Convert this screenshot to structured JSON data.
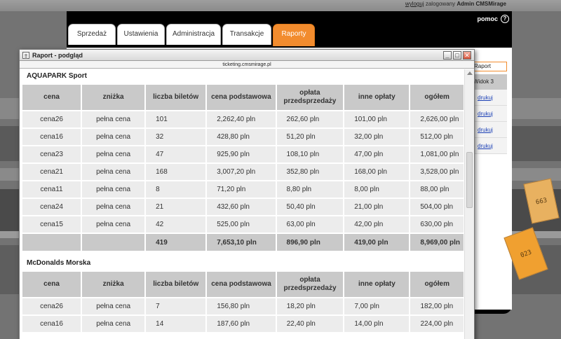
{
  "topbar": {
    "logout": "wyloguj",
    "logged_in": "zalogowany",
    "user": "Admin CMSMirage"
  },
  "app": {
    "help_label": "pomoc",
    "tabs": [
      {
        "label": "Sprzedaż"
      },
      {
        "label": "Ustawienia"
      },
      {
        "label": "Administracja"
      },
      {
        "label": "Transakcje"
      },
      {
        "label": "Raporty"
      }
    ],
    "active_tab": "Raporty",
    "accent_color": "#f28c2e",
    "side": {
      "header": "Raport",
      "view_label": "Widok 3",
      "links": [
        "drukuj",
        "drukuj",
        "drukuj",
        "drukuj"
      ]
    },
    "tickets": [
      "663",
      "023"
    ]
  },
  "window": {
    "title": "Raport - podgląd",
    "url": "ticketing.cmsmirage.pl",
    "buttons": {
      "minimize": "_",
      "maximize": "□",
      "close": "✕"
    }
  },
  "columns": [
    "cena",
    "zniżka",
    "liczba biletów",
    "cena podstawowa",
    "opłata przedsprzedaży",
    "inne opłaty",
    "ogółem"
  ],
  "sections": [
    {
      "title": "AQUAPARK Sport",
      "rows": [
        [
          "cena26",
          "pełna cena",
          "101",
          "2,262,40 pln",
          "262,60 pln",
          "101,00 pln",
          "2,626,00 pln"
        ],
        [
          "cena16",
          "pełna cena",
          "32",
          "428,80 pln",
          "51,20 pln",
          "32,00 pln",
          "512,00 pln"
        ],
        [
          "cena23",
          "pełna cena",
          "47",
          "925,90 pln",
          "108,10 pln",
          "47,00 pln",
          "1,081,00 pln"
        ],
        [
          "cena21",
          "pełna cena",
          "168",
          "3,007,20 pln",
          "352,80 pln",
          "168,00 pln",
          "3,528,00 pln"
        ],
        [
          "cena11",
          "pełna cena",
          "8",
          "71,20 pln",
          "8,80 pln",
          "8,00 pln",
          "88,00 pln"
        ],
        [
          "cena24",
          "pełna cena",
          "21",
          "432,60 pln",
          "50,40 pln",
          "21,00 pln",
          "504,00 pln"
        ],
        [
          "cena15",
          "pełna cena",
          "42",
          "525,00 pln",
          "63,00 pln",
          "42,00 pln",
          "630,00 pln"
        ]
      ],
      "total": [
        "",
        "",
        "419",
        "7,653,10 pln",
        "896,90 pln",
        "419,00 pln",
        "8,969,00 pln"
      ]
    },
    {
      "title": "McDonalds Morska",
      "rows": [
        [
          "cena26",
          "pełna cena",
          "7",
          "156,80 pln",
          "18,20 pln",
          "7,00 pln",
          "182,00 pln"
        ],
        [
          "cena16",
          "pełna cena",
          "14",
          "187,60 pln",
          "22,40 pln",
          "14,00 pln",
          "224,00 pln"
        ]
      ]
    }
  ]
}
